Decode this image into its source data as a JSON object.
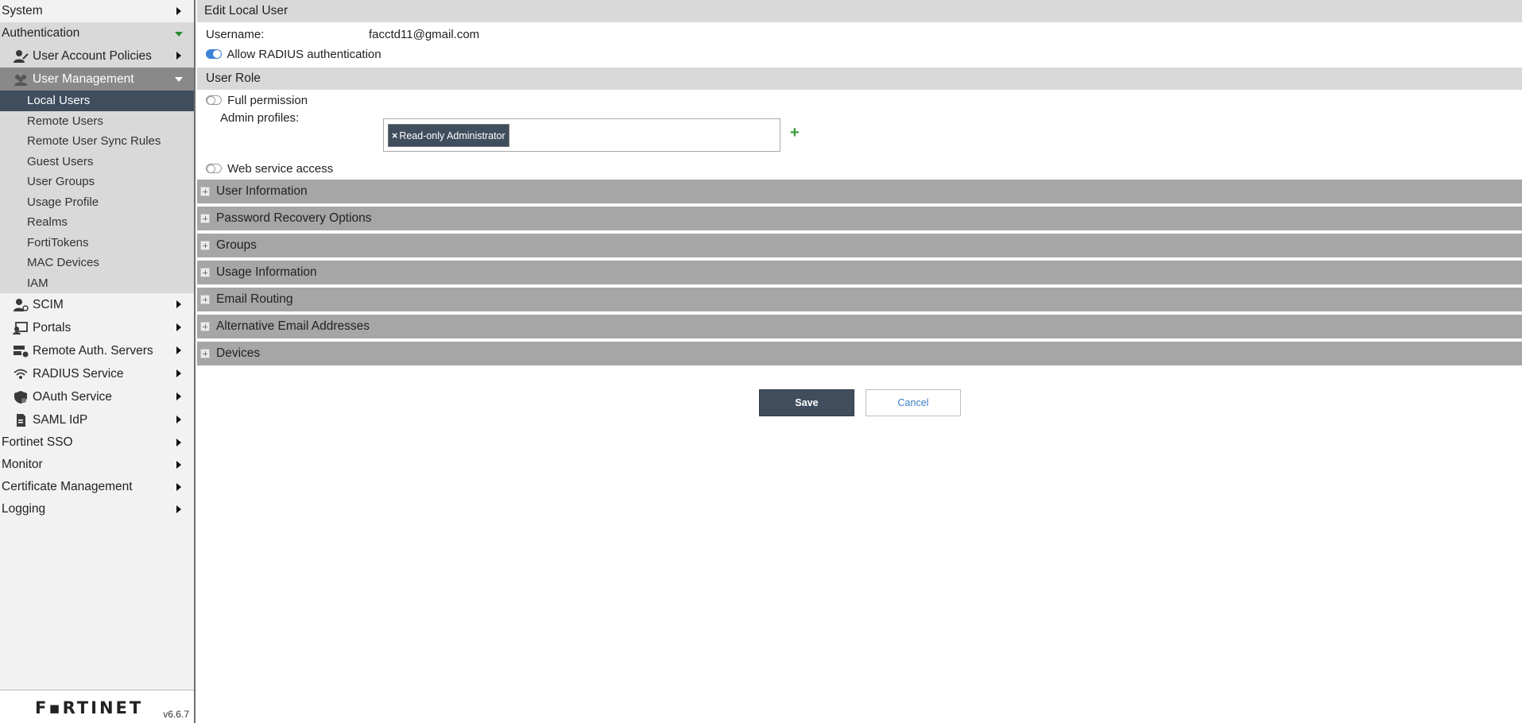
{
  "sidebar": {
    "top_items": [
      {
        "label": "System"
      },
      {
        "label": "Authentication"
      }
    ],
    "auth_items": {
      "user_account_policies": "User Account Policies",
      "user_management": "User Management",
      "user_management_children": [
        "Local Users",
        "Remote Users",
        "Remote User Sync Rules",
        "Guest Users",
        "User Groups",
        "Usage Profile",
        "Realms",
        "FortiTokens",
        "MAC Devices",
        "IAM"
      ],
      "scim": "SCIM",
      "portals": "Portals",
      "remote_auth_servers": "Remote Auth. Servers",
      "radius_service": "RADIUS Service",
      "oauth_service": "OAuth Service",
      "saml_idp": "SAML IdP"
    },
    "bottom_items": [
      "Fortinet SSO",
      "Monitor",
      "Certificate Management",
      "Logging"
    ],
    "brand": "F▪RTINET",
    "version": "v6.6.7"
  },
  "form": {
    "title": "Edit Local User",
    "username_label": "Username:",
    "username_value": "facctd11@gmail.com",
    "radius_label": "Allow RADIUS authentication",
    "radius_enabled": true,
    "user_role_title": "User Role",
    "full_permission_label": "Full permission",
    "full_permission_enabled": false,
    "admin_profiles_label": "Admin profiles:",
    "admin_profile_chip": "Read-only Administrator",
    "add_icon": "+",
    "web_service_label": "Web service access",
    "web_service_enabled": false,
    "sections": [
      "User Information",
      "Password Recovery Options",
      "Groups",
      "Usage Information",
      "Email Routing",
      "Alternative Email Addresses",
      "Devices"
    ],
    "save_label": "Save",
    "cancel_label": "Cancel"
  },
  "colors": {
    "selected_nav": "#3f4d5d",
    "toggle_on": "#3d82d6",
    "accent_green": "#3a9d3a",
    "section_bar": "#a6a6a6"
  }
}
